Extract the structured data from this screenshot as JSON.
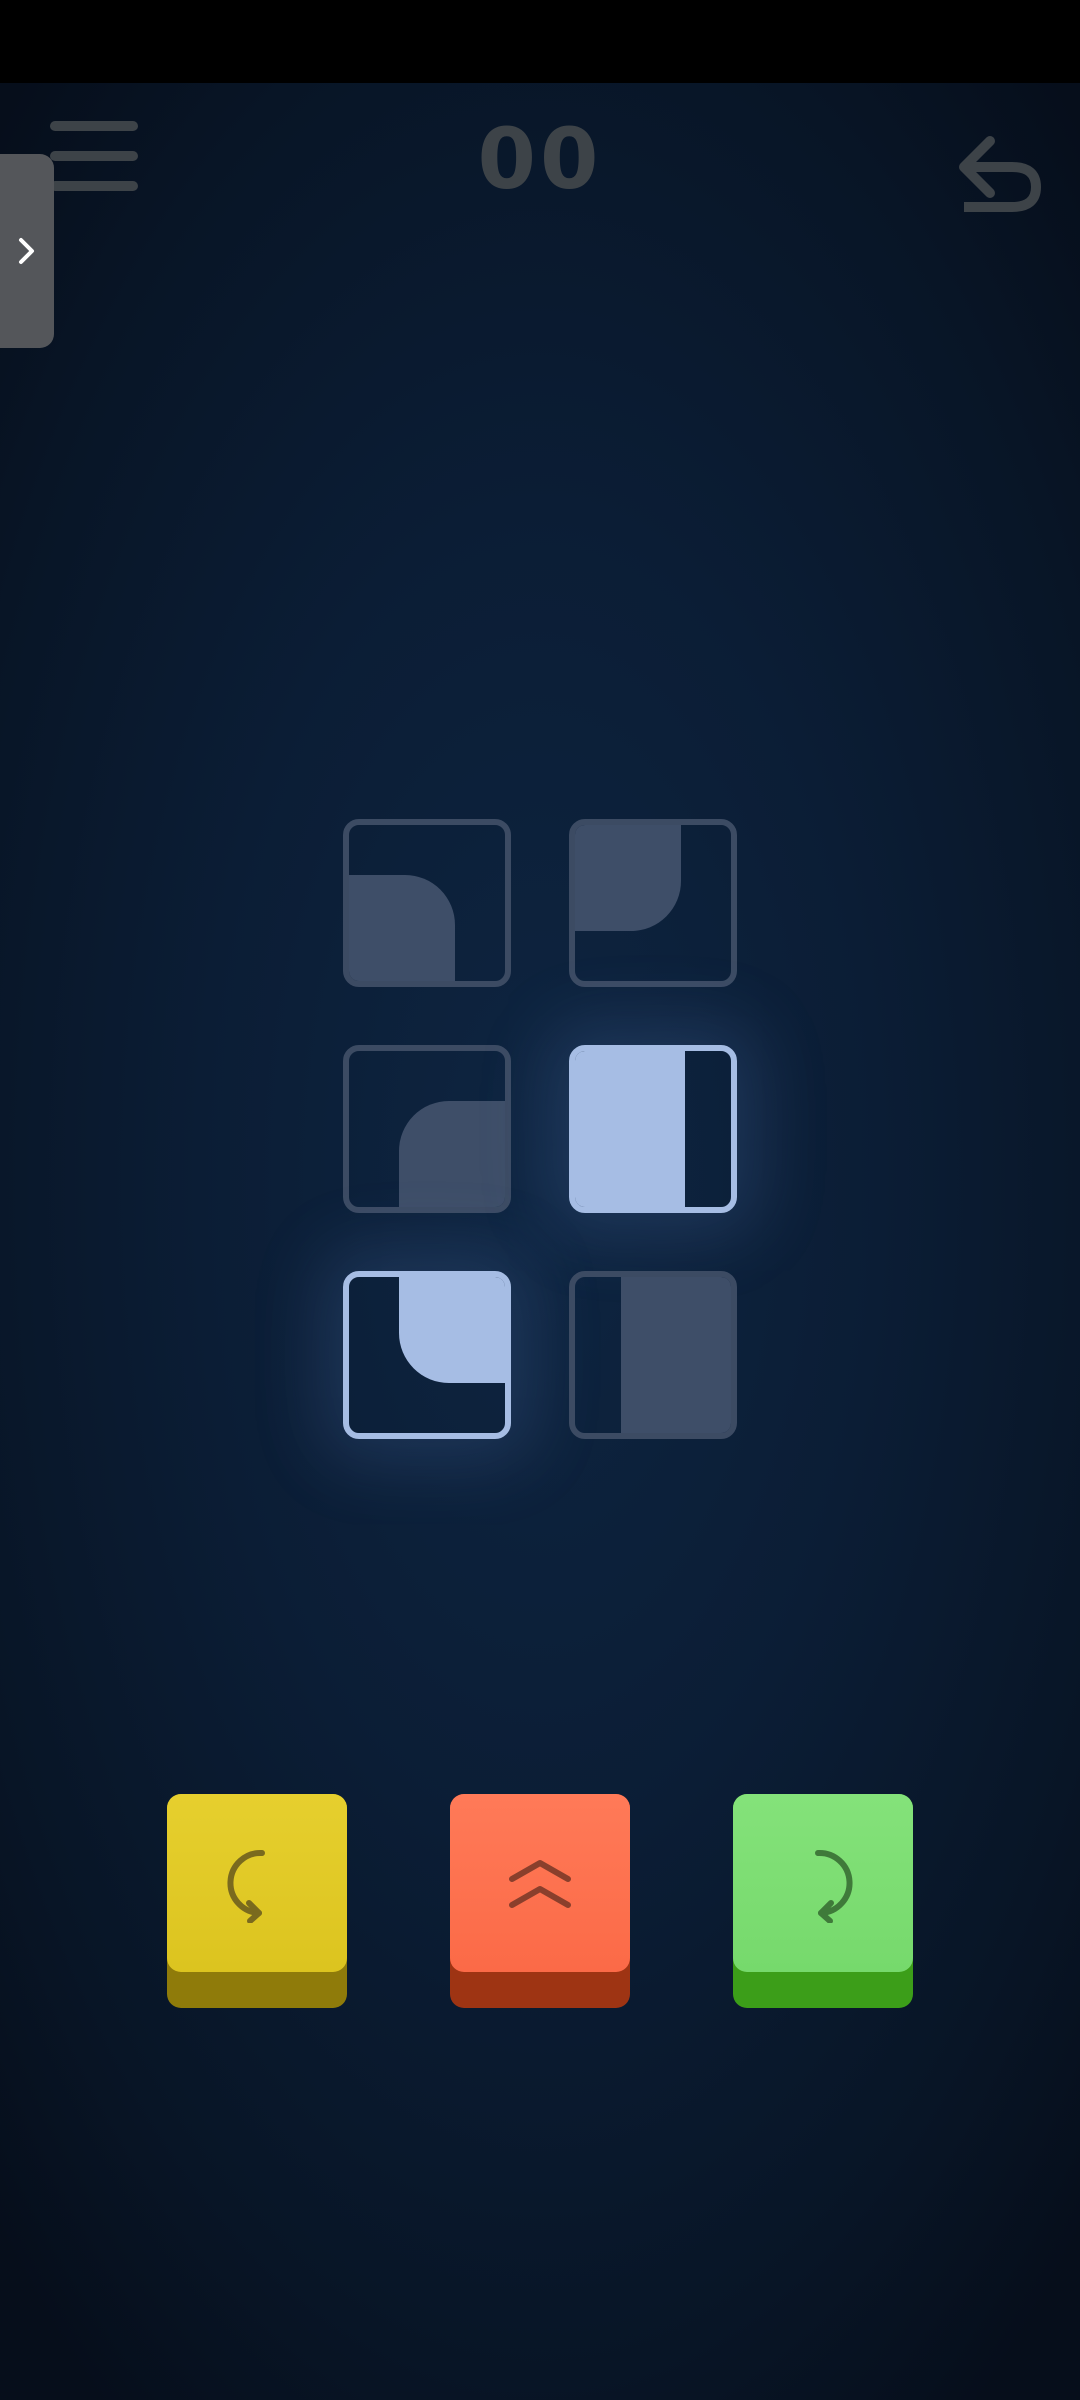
{
  "header": {
    "move_counter": "00",
    "menu_icon": "hamburger-menu-icon",
    "undo_icon": "undo-arrow-icon",
    "drawer_icon": "chevron-right-icon"
  },
  "board": {
    "rows": 3,
    "cols": 2,
    "tiles": [
      {
        "row": 1,
        "col": 1,
        "shape": "quarter-round",
        "highlighted": false
      },
      {
        "row": 1,
        "col": 2,
        "shape": "quarter-round",
        "highlighted": false
      },
      {
        "row": 2,
        "col": 1,
        "shape": "quarter-round",
        "highlighted": false
      },
      {
        "row": 2,
        "col": 2,
        "shape": "half-bar",
        "highlighted": true
      },
      {
        "row": 3,
        "col": 1,
        "shape": "quarter-round",
        "highlighted": true
      },
      {
        "row": 3,
        "col": 2,
        "shape": "half-bar",
        "highlighted": false
      }
    ]
  },
  "controls": [
    {
      "name": "rotate-left",
      "icon": "rotate-ccw-icon",
      "color": "#e0c826"
    },
    {
      "name": "flip",
      "icon": "double-chevron-up-icon",
      "color": "#fd704e"
    },
    {
      "name": "rotate-right",
      "icon": "rotate-cw-icon",
      "color": "#7ad972"
    }
  ],
  "colors": {
    "tile_dim": "#3e4e68",
    "tile_highlight": "#a6bde4",
    "background": "#0b1d35"
  }
}
